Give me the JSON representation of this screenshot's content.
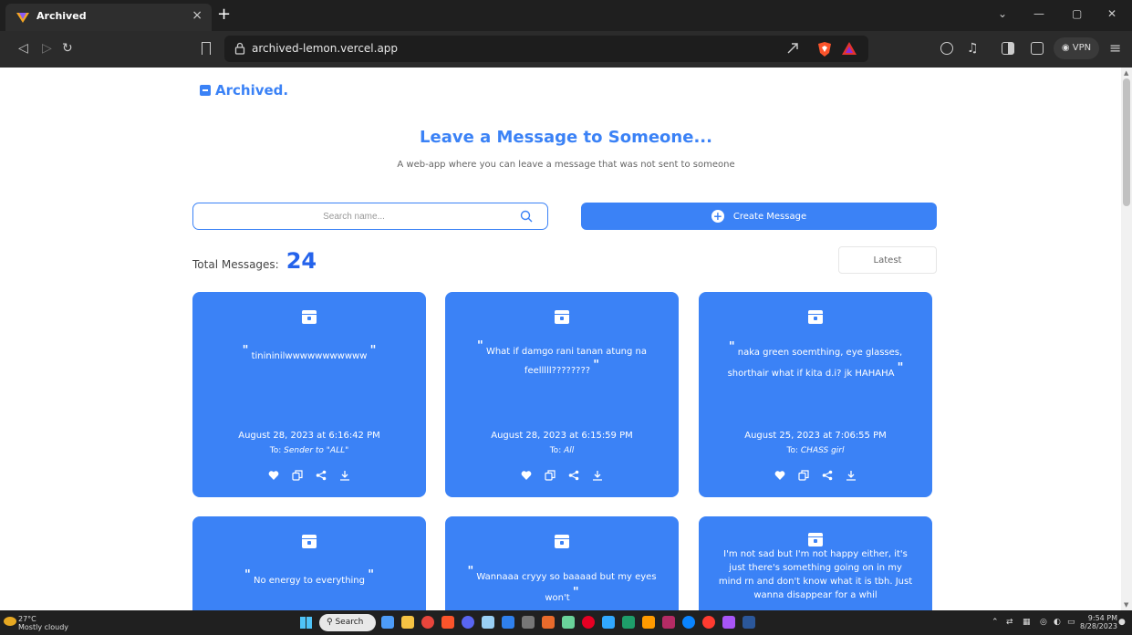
{
  "browser": {
    "tab_title": "Archived",
    "tab_close": "×",
    "new_tab": "+",
    "url": "archived-lemon.vercel.app",
    "vpn_label": "VPN",
    "win_min": "—",
    "win_max": "▢",
    "win_close": "✕",
    "win_chevron": "⌄"
  },
  "app": {
    "brand": "Archived.",
    "hero_title": "Leave a Message to Someone...",
    "hero_subtitle": "A web-app where you can leave a message that was not sent to someone",
    "search_placeholder": "Search name...",
    "create_label": "Create Message",
    "total_label": "Total Messages:",
    "total_count": "24",
    "sort_value": "Latest"
  },
  "cards": [
    {
      "message": "tinininilwwwwwwwwwww",
      "date": "August 28, 2023 at 6:16:42 PM",
      "to_prefix": "To:",
      "to": "Sender to \"ALL\""
    },
    {
      "message": "What if damgo rani tanan atung na feelllll????????",
      "date": "August 28, 2023 at 6:15:59 PM",
      "to_prefix": "To:",
      "to": "All"
    },
    {
      "message": "naka green soemthing, eye glasses, shorthair what if kita d.i? jk HAHAHA",
      "date": "August 25, 2023 at 7:06:55 PM",
      "to_prefix": "To:",
      "to": "CHASS girl"
    },
    {
      "message": "No energy to everything"
    },
    {
      "message": "Wannaaa cryyy so baaaad but my eyes won't"
    },
    {
      "message": "I'm not sad but I'm not happy either, it's just there's something going on in my mind rn and don't know what it is tbh. Just wanna disappear for a whil"
    }
  ],
  "taskbar": {
    "temperature": "27°C",
    "weather": "Mostly cloudy",
    "search_label": "Search",
    "time": "9:54 PM",
    "date": "8/28/2023"
  },
  "colors": {
    "accent": "#3b82f6",
    "accent_dark": "#2563eb"
  }
}
